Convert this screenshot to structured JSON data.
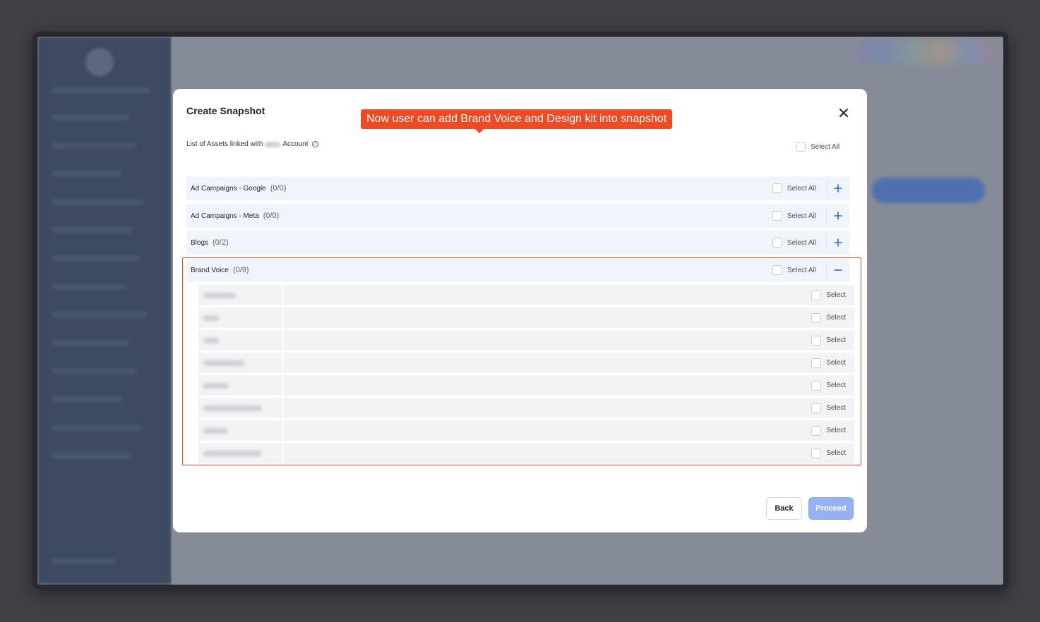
{
  "modal": {
    "title": "Create Snapshot",
    "callout": "Now user can add Brand Voice and Design kit into snapshot",
    "subtitle_prefix": "List of Assets linked with",
    "subtitle_suffix": "Account",
    "select_all_label": "Select All"
  },
  "sections": [
    {
      "name": "Ad Campaigns - Google",
      "count": "(0/0)",
      "select_label": "Select All",
      "expanded": false
    },
    {
      "name": "Ad Campaigns - Meta",
      "count": "(0/0)",
      "select_label": "Select All",
      "expanded": false
    },
    {
      "name": "Blogs",
      "count": "(0/2)",
      "select_label": "Select All",
      "expanded": false
    },
    {
      "name": "Brand Voice",
      "count": "(0/9)",
      "select_label": "Select All",
      "expanded": true
    }
  ],
  "brand_voice_items": [
    {
      "select_label": "Select"
    },
    {
      "select_label": "Select"
    },
    {
      "select_label": "Select"
    },
    {
      "select_label": "Select"
    },
    {
      "select_label": "Select"
    },
    {
      "select_label": "Select"
    },
    {
      "select_label": "Select"
    },
    {
      "select_label": "Select"
    }
  ],
  "footer": {
    "back_label": "Back",
    "proceed_label": "Proceed"
  },
  "colors": {
    "accent": "#2a67d6",
    "callout": "#f04a24",
    "proceed_disabled": "#93b1f4"
  }
}
